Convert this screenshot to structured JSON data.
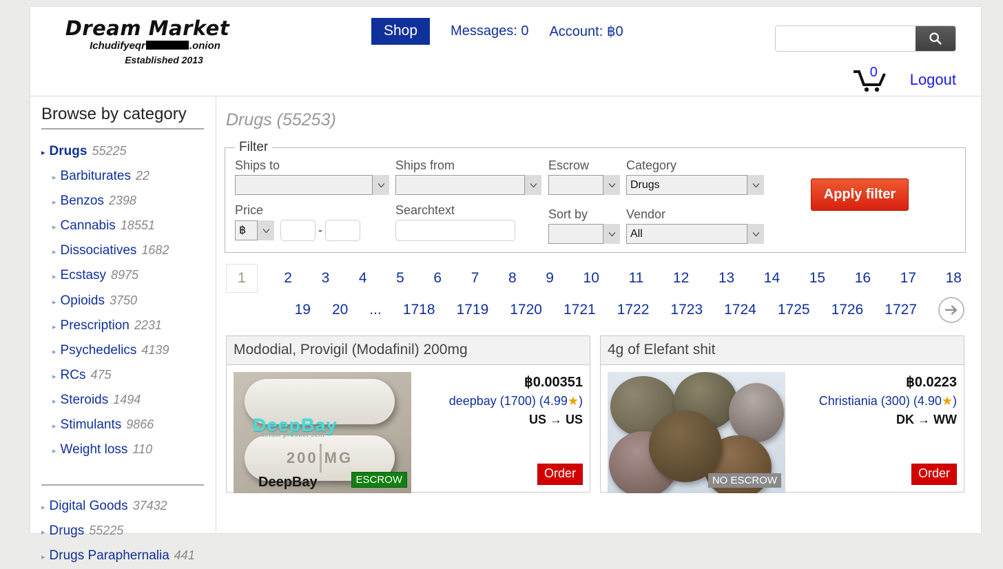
{
  "site": {
    "logo_title": "Dream Market",
    "onion_prefix": "Ichudifyeqr",
    "onion_suffix": ".onion",
    "established": "Established 2013"
  },
  "nav": {
    "shop": "Shop",
    "messages": "Messages: 0",
    "account": "Account: ฿0",
    "logout": "Logout",
    "cart_count": "0",
    "search_value": "",
    "search_placeholder": "",
    "search_icon": "search-icon",
    "cart_icon": "cart-icon"
  },
  "sidebar": {
    "title": "Browse by category",
    "current": [
      {
        "label": "Drugs",
        "count": "55225",
        "level": "root"
      },
      {
        "label": "Barbiturates",
        "count": "22",
        "level": "sub"
      },
      {
        "label": "Benzos",
        "count": "2398",
        "level": "sub"
      },
      {
        "label": "Cannabis",
        "count": "18551",
        "level": "sub"
      },
      {
        "label": "Dissociatives",
        "count": "1682",
        "level": "sub"
      },
      {
        "label": "Ecstasy",
        "count": "8975",
        "level": "sub"
      },
      {
        "label": "Opioids",
        "count": "3750",
        "level": "sub"
      },
      {
        "label": "Prescription",
        "count": "2231",
        "level": "sub"
      },
      {
        "label": "Psychedelics",
        "count": "4139",
        "level": "sub"
      },
      {
        "label": "RCs",
        "count": "475",
        "level": "sub"
      },
      {
        "label": "Steroids",
        "count": "1494",
        "level": "sub"
      },
      {
        "label": "Stimulants",
        "count": "9866",
        "level": "sub"
      },
      {
        "label": "Weight loss",
        "count": "110",
        "level": "sub"
      }
    ],
    "all": [
      {
        "label": "Digital Goods",
        "count": "37432"
      },
      {
        "label": "Drugs",
        "count": "55225"
      },
      {
        "label": "Drugs Paraphernalia",
        "count": "441"
      }
    ]
  },
  "main": {
    "page_title": "Drugs (55253)",
    "filter": {
      "legend": "Filter",
      "ships_to_label": "Ships to",
      "ships_to_value": "",
      "ships_from_label": "Ships from",
      "ships_from_value": "",
      "escrow_label": "Escrow",
      "escrow_value": "",
      "category_label": "Category",
      "category_value": "Drugs",
      "price_label": "Price",
      "currency_value": "฿",
      "price_min": "",
      "price_max": "",
      "price_separator": "-",
      "searchtext_label": "Searchtext",
      "searchtext_value": "",
      "sort_by_label": "Sort by",
      "sort_by_value": "",
      "vendor_label": "Vendor",
      "vendor_value": "All",
      "apply_label": "Apply filter"
    },
    "pagination": {
      "current": "1",
      "row1": [
        "2",
        "3",
        "4",
        "5",
        "6",
        "7",
        "8",
        "9",
        "10",
        "11",
        "12",
        "13",
        "14",
        "15",
        "16",
        "17",
        "18"
      ],
      "row2": [
        "19",
        "20",
        "...",
        "1718",
        "1719",
        "1720",
        "1721",
        "1722",
        "1723",
        "1724",
        "1725",
        "1726",
        "1727"
      ],
      "next_icon": "arrow-right-icon"
    },
    "products": [
      {
        "title": "Mododial, Provigil (Modafinil) 200mg",
        "price": "฿0.00351",
        "vendor": "deepbay (1700) (4.99",
        "vendor_tail": ")",
        "ship": "US → US",
        "escrow_badge": "ESCROW",
        "escrow_type": "escrow",
        "order_label": "Order",
        "image_text_watermark": "DeepBay",
        "image_text_sub": "actual product sent",
        "image_text_bottom": "DeepBay",
        "image_text_dose": "200  MG"
      },
      {
        "title": "4g of Elefant shit",
        "price": "฿0.0223",
        "vendor": "Christiania (300) (4.90",
        "vendor_tail": ")",
        "ship": "DK → WW",
        "escrow_badge": "NO ESCROW",
        "escrow_type": "noescrow",
        "order_label": "Order"
      }
    ]
  },
  "colors": {
    "brand_blue": "#10309b",
    "link_blue": "#1a1aee",
    "apply_red": "#d8210f",
    "order_red": "#d40000",
    "escrow_green": "#128012",
    "noescrow_gray": "#8a8a8a",
    "star_gold": "#f0a000",
    "page_bg": "#ebebe9"
  }
}
